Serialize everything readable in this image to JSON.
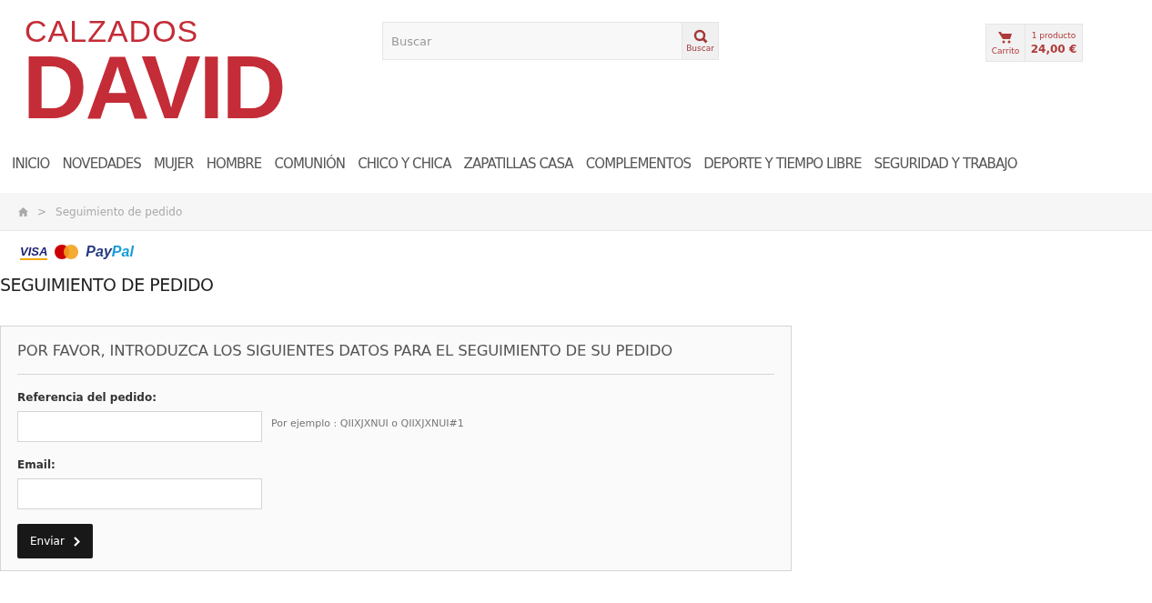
{
  "logo": {
    "line_1": "CALZADOS",
    "line_2": "DAVID"
  },
  "search": {
    "placeholder": "Buscar",
    "button_label": "Buscar"
  },
  "cart": {
    "label": "Carrito",
    "count": "1 producto",
    "total": "24,00 €"
  },
  "nav": {
    "items": [
      "INICIO",
      "NOVEDADES",
      "MUJER",
      "HOMBRE",
      "COMUNIÓN",
      "CHICO Y CHICA",
      "ZAPATILLAS CASA",
      "COMPLEMENTOS",
      "DEPORTE Y TIEMPO LIBRE",
      "SEGURIDAD Y TRABAJO"
    ]
  },
  "breadcrumb": {
    "separator": ">",
    "current": "Seguimiento de pedido"
  },
  "payment_logos": {
    "visa": "VISA",
    "paypal_1": "Pay",
    "paypal_2": "Pal"
  },
  "page_title": "SEGUIMIENTO DE PEDIDO",
  "form": {
    "heading": "POR FAVOR, INTRODUZCA LOS SIGUIENTES DATOS PARA EL SEGUIMIENTO DE SU PEDIDO",
    "fields": [
      {
        "label": "Referencia del pedido:",
        "hint": "Por ejemplo : QIIXJXNUI o QIIXJXNUI#1"
      },
      {
        "label": "Email:"
      }
    ],
    "submit": "Enviar"
  }
}
